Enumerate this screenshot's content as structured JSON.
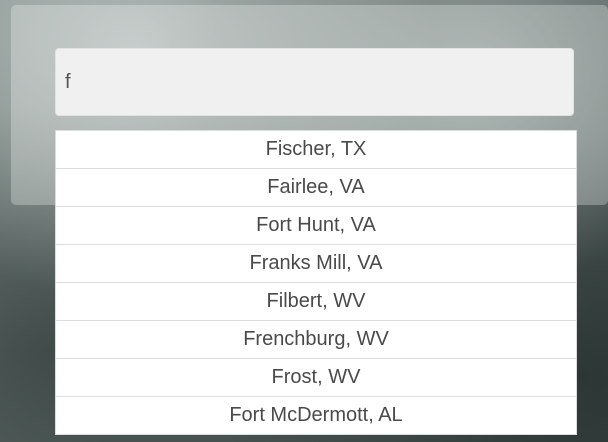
{
  "search": {
    "value": "f"
  },
  "suggestions": [
    {
      "label": "Fischer, TX"
    },
    {
      "label": "Fairlee, VA"
    },
    {
      "label": "Fort Hunt, VA"
    },
    {
      "label": "Franks Mill, VA"
    },
    {
      "label": "Filbert, WV"
    },
    {
      "label": "Frenchburg, WV"
    },
    {
      "label": "Frost, WV"
    },
    {
      "label": "Fort McDermott, AL"
    }
  ]
}
